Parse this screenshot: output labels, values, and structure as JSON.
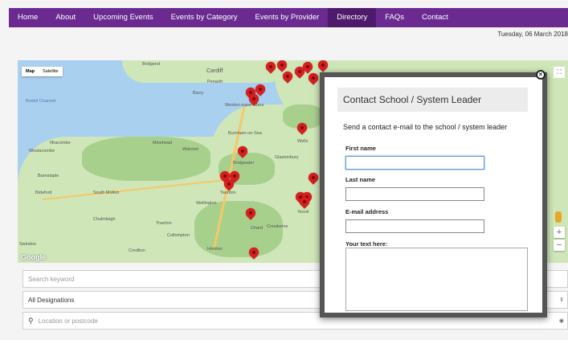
{
  "nav": {
    "items": [
      "Home",
      "About",
      "Upcoming Events",
      "Events by Category",
      "Events by Provider",
      "Directory",
      "FAQs",
      "Contact"
    ],
    "active_index": 5
  },
  "date": "Tuesday, 06 March 2018",
  "map": {
    "map_type_options": [
      "Map",
      "Satellite"
    ],
    "labels": [
      "Bridgend",
      "Cardiff",
      "Penarth",
      "Barry",
      "Bristol Channel",
      "Weston-super-Mare",
      "Burnham-on-Sea",
      "Minehead",
      "Watchet",
      "Bridgwater",
      "Glastonbury",
      "Wells",
      "Woolacombe",
      "Ilfracombe",
      "Barnstaple",
      "Bideford",
      "South Molton",
      "Wellington",
      "Taunton",
      "Tiverton",
      "Chulmleigh",
      "Cullompton",
      "Crediton",
      "Honiton",
      "Chard",
      "Crewkerne",
      "Yeovil",
      "Swindon",
      "Google"
    ],
    "zoom_in": "+",
    "zoom_out": "−"
  },
  "filters": {
    "search_placeholder": "Search keyword",
    "designation_value": "All Designations",
    "location_placeholder": "Location or postcode"
  },
  "modal": {
    "title": "Contact School / System Leader",
    "intro": "Send a contact e-mail to the school / system leader",
    "first_name_label": "First name",
    "last_name_label": "Last name",
    "email_label": "E-mail address",
    "text_label": "Your text here:",
    "close": "×"
  },
  "colors": {
    "nav_bg": "#6b2a8f",
    "nav_active": "#4e1b6c",
    "pin": "#d81e1e"
  }
}
